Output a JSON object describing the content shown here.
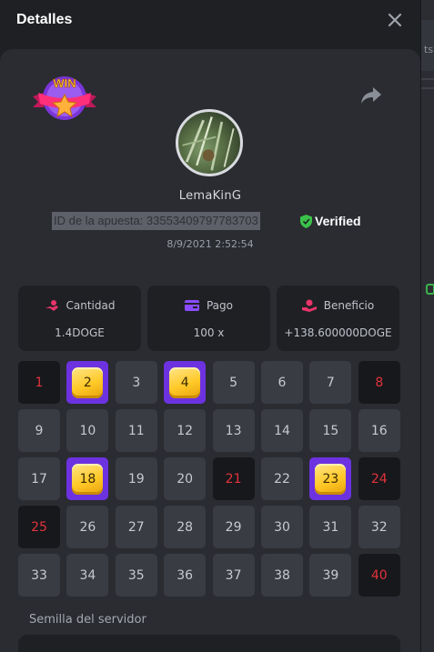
{
  "header": {
    "title": "Detalles"
  },
  "badge": {
    "text": "WIN"
  },
  "user": {
    "name": "LemaKinG"
  },
  "bet": {
    "id_text": "ID de la apuesta: 33553409797783703",
    "verified_label": "Verified",
    "date": "8/9/2021 2:52:54"
  },
  "stats": [
    {
      "label": "Cantidad",
      "value": "1.4DOGE",
      "icon": "coins-icon",
      "color": "#e8356a"
    },
    {
      "label": "Pago",
      "value": "100 x",
      "icon": "wallet-icon",
      "color": "#8a4bff"
    },
    {
      "label": "Beneficio",
      "value": "+138.600000DOGE",
      "icon": "profit-hand-icon",
      "color": "#e8356a"
    }
  ],
  "grid": {
    "numbers": [
      1,
      2,
      3,
      4,
      5,
      6,
      7,
      8,
      9,
      10,
      11,
      12,
      13,
      14,
      15,
      16,
      17,
      18,
      19,
      20,
      21,
      22,
      23,
      24,
      25,
      26,
      27,
      28,
      29,
      30,
      31,
      32,
      33,
      34,
      35,
      36,
      37,
      38,
      39,
      40
    ],
    "hits": [
      2,
      4,
      18,
      23
    ],
    "drawn_miss": [
      1,
      8,
      21,
      24,
      25,
      40
    ]
  },
  "seed": {
    "label": "Semilla del servidor"
  },
  "colors": {
    "accent": "#6d32e0",
    "miss": "#e2323c",
    "verified": "#3bc24a",
    "gem": "#ffc928"
  }
}
